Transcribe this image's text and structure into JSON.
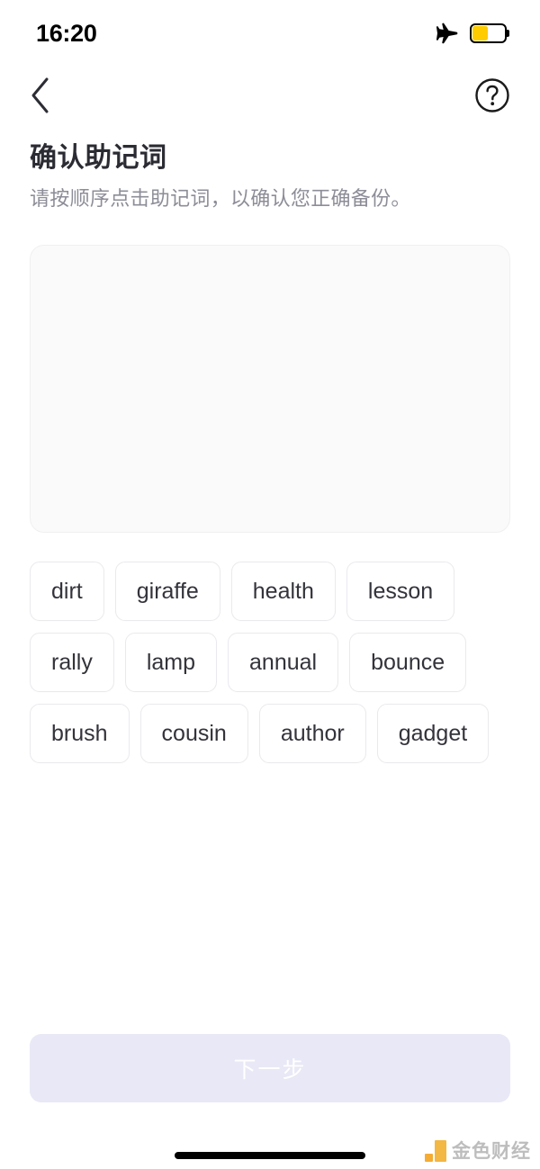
{
  "status_bar": {
    "time": "16:20",
    "airplane_icon": "airplane-icon",
    "battery_icon": "battery-icon",
    "battery_level_percent": 45,
    "battery_color": "#ffcc00"
  },
  "nav": {
    "back_icon": "chevron-left-icon",
    "help_icon": "question-circle-icon"
  },
  "header": {
    "title": "确认助记词",
    "subtitle": "请按顺序点击助记词，以确认您正确备份。"
  },
  "drop_zone": {
    "selected_words": [],
    "empty": true
  },
  "word_pool": {
    "words": [
      "dirt",
      "giraffe",
      "health",
      "lesson",
      "rally",
      "lamp",
      "annual",
      "bounce",
      "brush",
      "cousin",
      "author",
      "gadget"
    ]
  },
  "footer": {
    "next_label": "下一步",
    "next_enabled": false,
    "next_bg_color": "#e8e8f6",
    "next_text_color": "#ffffff"
  },
  "watermark": {
    "text": "金色财经",
    "logo_color": "#f2b134"
  }
}
